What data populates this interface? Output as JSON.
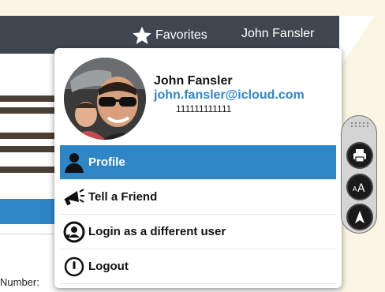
{
  "header": {
    "favorites_label": "Favorites",
    "user_name": "John Fansler"
  },
  "background": {
    "number_label": "Number:"
  },
  "profile": {
    "name": "John Fansler",
    "email": "john.fansler@icloud.com",
    "phone": "111111111111"
  },
  "menu": {
    "items": [
      {
        "label": "Profile",
        "icon": "person-icon",
        "active": true
      },
      {
        "label": "Tell a Friend",
        "icon": "megaphone-icon",
        "active": false
      },
      {
        "label": "Login as a different user",
        "icon": "switch-user-icon",
        "active": false
      },
      {
        "label": "Logout",
        "icon": "power-icon",
        "active": false
      }
    ]
  },
  "toolbar": {
    "icons": [
      "grip-icon",
      "print-icon",
      "text-size-icon",
      "navigation-icon"
    ]
  },
  "colors": {
    "header_bg": "#3f4650",
    "accent_blue": "#2f86c7",
    "caret_red": "#e8231b",
    "page_bg": "#fbf5e6"
  }
}
